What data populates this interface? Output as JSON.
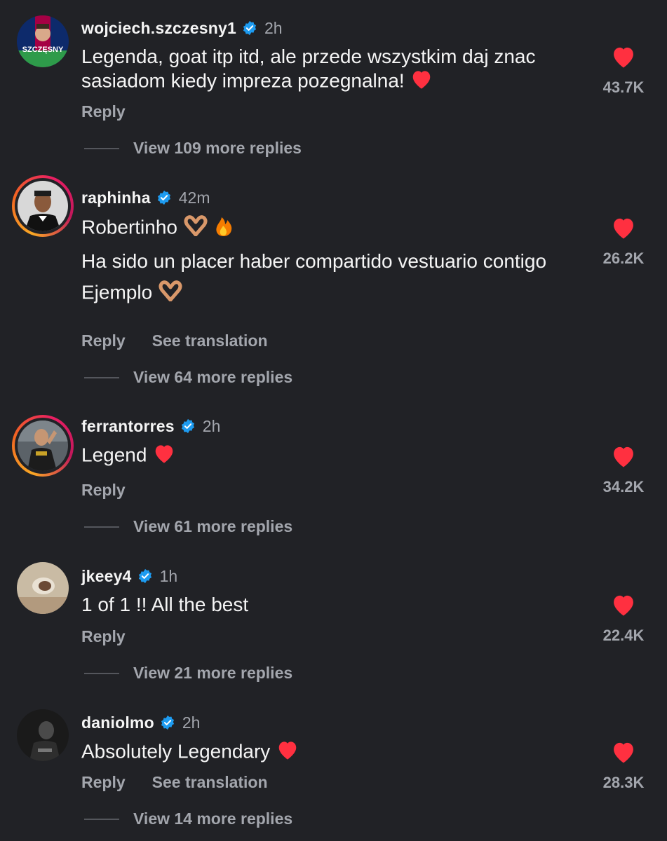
{
  "colors": {
    "background": "#212226",
    "heart": "#ff3040",
    "verified": "#1d9bf0"
  },
  "comments": [
    {
      "username": "wojciech.szczesny1",
      "time": "2h",
      "lines": [
        "Legenda, goat itp itd, ale przede wszystkim daj znac sasiadom kiedy impreza pozegnalna!"
      ],
      "likes": "43.7K",
      "reply": "Reply",
      "view_replies": "View 109 more replies",
      "avatar_text": "SZCZĘSNY"
    },
    {
      "username": "raphinha",
      "time": "42m",
      "lines": [
        "Robertinho",
        "Ha sido un placer haber compartido vestuario contigo",
        "Ejemplo"
      ],
      "likes": "26.2K",
      "reply": "Reply",
      "translate": "See translation",
      "view_replies": "View 64 more replies"
    },
    {
      "username": "ferrantorres",
      "time": "2h",
      "lines": [
        "Legend"
      ],
      "likes": "34.2K",
      "reply": "Reply",
      "view_replies": "View 61 more replies"
    },
    {
      "username": "jkeey4",
      "time": "1h",
      "lines": [
        "1 of 1 !! All the best"
      ],
      "likes": "22.4K",
      "reply": "Reply",
      "view_replies": "View 21 more replies"
    },
    {
      "username": "daniolmo",
      "time": "2h",
      "lines": [
        "Absolutely Legendary"
      ],
      "likes": "28.3K",
      "reply": "Reply",
      "translate": "See translation",
      "view_replies": "View 14 more replies"
    }
  ]
}
